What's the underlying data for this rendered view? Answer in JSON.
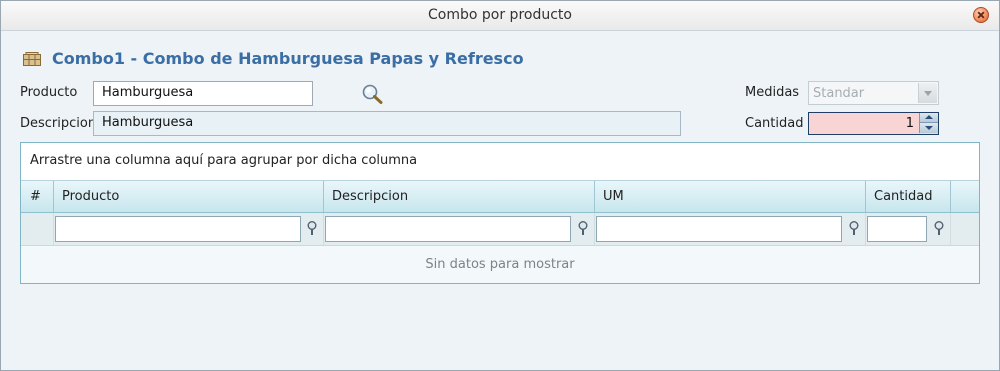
{
  "window": {
    "title": "Combo por producto"
  },
  "combo": {
    "title": "Combo1 - Combo de Hamburguesa Papas y Refresco"
  },
  "form": {
    "producto_label": "Producto",
    "producto_value": "Hamburguesa",
    "descripcion_label": "Descripcion",
    "descripcion_value": "Hamburguesa",
    "medidas_label": "Medidas",
    "medidas_value": "Standar",
    "cantidad_label": "Cantidad",
    "cantidad_value": "1"
  },
  "grid": {
    "group_hint": "Arrastre una columna aquí para agrupar por dicha columna",
    "columns": [
      "#",
      "Producto",
      "Descripcion",
      "UM",
      "Cantidad"
    ],
    "empty_text": "Sin datos para mostrar"
  },
  "icons": {
    "close": "close-icon",
    "box": "box-icon",
    "search": "search-icon",
    "filter": "filter-icon"
  }
}
